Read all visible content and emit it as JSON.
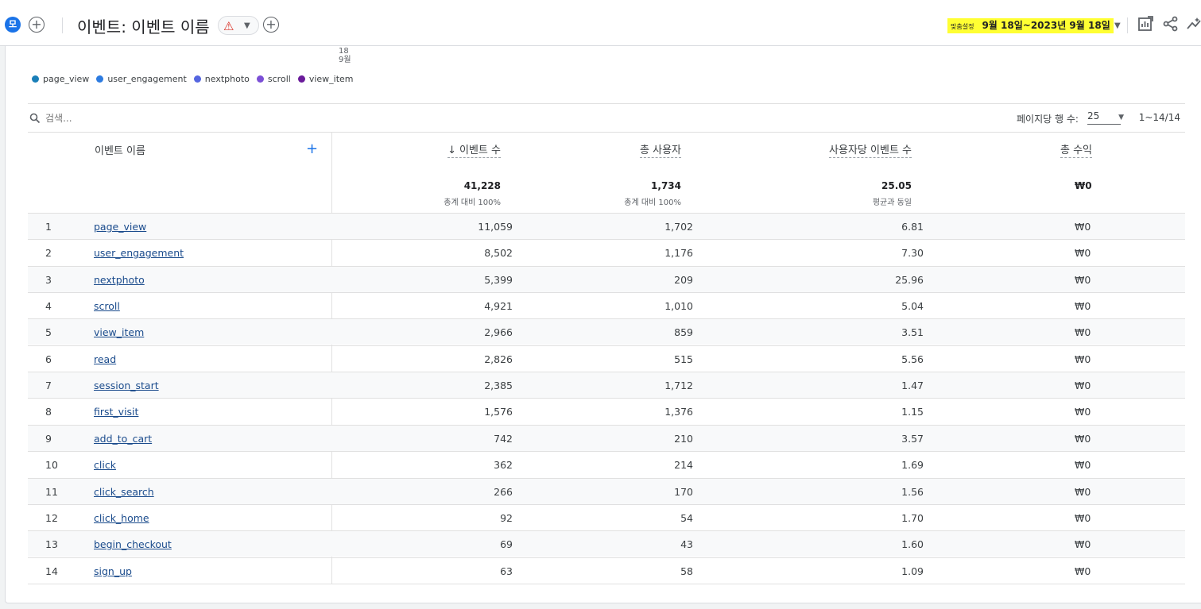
{
  "header": {
    "avatar_letter": "모",
    "title": "이벤트: 이벤트 이름",
    "date_label": "맞춤설정",
    "date_range": "9월 18일~2023년 9월 18일",
    "icons": [
      "edit-report-icon",
      "share-icon",
      "insights-icon"
    ]
  },
  "chart_axis": {
    "tick_day": "18",
    "tick_month": "9월"
  },
  "legend": [
    {
      "label": "page_view",
      "color": "#1a7fb8"
    },
    {
      "label": "user_engagement",
      "color": "#2d7be0"
    },
    {
      "label": "nextphoto",
      "color": "#5566e0"
    },
    {
      "label": "scroll",
      "color": "#7b4fd6"
    },
    {
      "label": "view_item",
      "color": "#6a1b9a"
    }
  ],
  "search": {
    "placeholder": "검색..."
  },
  "pagination": {
    "rows_label": "페이지당 행 수:",
    "rows_value": "25",
    "range": "1~14/14"
  },
  "table": {
    "columns": {
      "name": "이벤트 이름",
      "events": "이벤트 수",
      "users": "총 사용자",
      "per_user": "사용자당 이벤트 수",
      "revenue": "총 수익"
    },
    "totals": {
      "events": "41,228",
      "events_sub": "총계 대비 100%",
      "users": "1,734",
      "users_sub": "총계 대비 100%",
      "per_user": "25.05",
      "per_user_sub": "평균과 동일",
      "revenue": "₩0"
    },
    "rows": [
      {
        "idx": "1",
        "name": "page_view",
        "events": "11,059",
        "users": "1,702",
        "per_user": "6.81",
        "revenue": "₩0"
      },
      {
        "idx": "2",
        "name": "user_engagement",
        "events": "8,502",
        "users": "1,176",
        "per_user": "7.30",
        "revenue": "₩0"
      },
      {
        "idx": "3",
        "name": "nextphoto",
        "events": "5,399",
        "users": "209",
        "per_user": "25.96",
        "revenue": "₩0"
      },
      {
        "idx": "4",
        "name": "scroll",
        "events": "4,921",
        "users": "1,010",
        "per_user": "5.04",
        "revenue": "₩0"
      },
      {
        "idx": "5",
        "name": "view_item",
        "events": "2,966",
        "users": "859",
        "per_user": "3.51",
        "revenue": "₩0"
      },
      {
        "idx": "6",
        "name": "read",
        "events": "2,826",
        "users": "515",
        "per_user": "5.56",
        "revenue": "₩0"
      },
      {
        "idx": "7",
        "name": "session_start",
        "events": "2,385",
        "users": "1,712",
        "per_user": "1.47",
        "revenue": "₩0"
      },
      {
        "idx": "8",
        "name": "first_visit",
        "events": "1,576",
        "users": "1,376",
        "per_user": "1.15",
        "revenue": "₩0"
      },
      {
        "idx": "9",
        "name": "add_to_cart",
        "events": "742",
        "users": "210",
        "per_user": "3.57",
        "revenue": "₩0"
      },
      {
        "idx": "10",
        "name": "click",
        "events": "362",
        "users": "214",
        "per_user": "1.69",
        "revenue": "₩0"
      },
      {
        "idx": "11",
        "name": "click_search",
        "events": "266",
        "users": "170",
        "per_user": "1.56",
        "revenue": "₩0"
      },
      {
        "idx": "12",
        "name": "click_home",
        "events": "92",
        "users": "54",
        "per_user": "1.70",
        "revenue": "₩0"
      },
      {
        "idx": "13",
        "name": "begin_checkout",
        "events": "69",
        "users": "43",
        "per_user": "1.60",
        "revenue": "₩0"
      },
      {
        "idx": "14",
        "name": "sign_up",
        "events": "63",
        "users": "58",
        "per_user": "1.09",
        "revenue": "₩0"
      }
    ]
  }
}
